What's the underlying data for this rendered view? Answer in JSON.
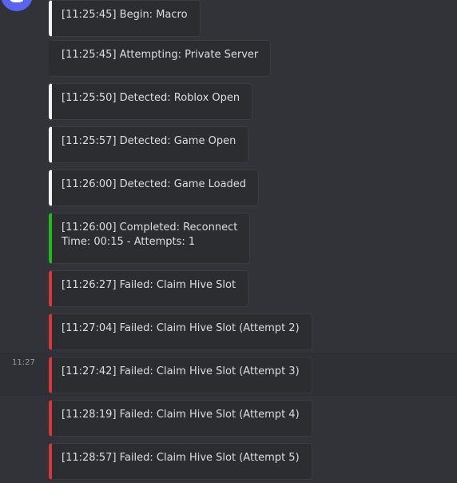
{
  "avatar": {
    "icon": "discord-bot-avatar",
    "color": "#5865f2"
  },
  "messages": [
    {
      "lines": [
        "[11:25:45] Begin: Macro"
      ],
      "color": "#f2f3f5",
      "timestamp": ""
    },
    {
      "lines": [
        "[11:25:45] Attempting: Private Server"
      ],
      "color": "none",
      "timestamp": ""
    },
    {
      "lines": [
        "[11:25:50] Detected: Roblox Open"
      ],
      "color": "#f2f3f5",
      "timestamp": ""
    },
    {
      "lines": [
        "[11:25:57] Detected: Game Open"
      ],
      "color": "#f2f3f5",
      "timestamp": ""
    },
    {
      "lines": [
        "[11:26:00] Detected: Game Loaded"
      ],
      "color": "#f2f3f5",
      "timestamp": ""
    },
    {
      "lines": [
        "[11:26:00] Completed: Reconnect",
        "Time: 00:15 - Attempts: 1"
      ],
      "color": "#1fbb1a",
      "timestamp": ""
    },
    {
      "lines": [
        "[11:26:27] Failed: Claim Hive Slot"
      ],
      "color": "#da373c",
      "timestamp": ""
    },
    {
      "lines": [
        "[11:27:04] Failed: Claim Hive Slot (Attempt 2)"
      ],
      "color": "#da373c",
      "timestamp": ""
    },
    {
      "lines": [
        "[11:27:42] Failed: Claim Hive Slot (Attempt 3)"
      ],
      "color": "#da373c",
      "timestamp": "11:27"
    },
    {
      "lines": [
        "[11:28:19] Failed: Claim Hive Slot (Attempt 4)"
      ],
      "color": "#da373c",
      "timestamp": ""
    },
    {
      "lines": [
        "[11:28:57] Failed: Claim Hive Slot (Attempt 5)"
      ],
      "color": "#da373c",
      "timestamp": ""
    }
  ],
  "colors": {
    "background": "#313338",
    "embed_background": "#2b2d31",
    "text": "#dbdee1",
    "timestamp": "#949ba4",
    "success": "#1fbb1a",
    "failure": "#da373c",
    "neutral": "#f2f3f5"
  }
}
